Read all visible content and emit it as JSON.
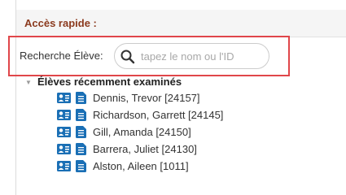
{
  "panel": {
    "title": "Accès rapide :"
  },
  "search": {
    "label": "Recherche Élève:",
    "placeholder": "tapez le nom ou l'ID",
    "value": "",
    "icon": "search-icon"
  },
  "recent": {
    "title": "Élèves récemment examinés",
    "toggle_icon": "caret-down-icon",
    "students": [
      {
        "label": "Dennis, Trevor [24157]"
      },
      {
        "label": "Richardson, Garrett [24145]"
      },
      {
        "label": "Gill, Amanda [24150]"
      },
      {
        "label": "Barrera, Juliet [24130]"
      },
      {
        "label": "Alston, Aileen [1011]"
      }
    ]
  },
  "colors": {
    "title": "#8b3a1e",
    "icon_blue": "#1a6fb5",
    "highlight": "#e0464a",
    "header_bg": "#f5f5f5"
  }
}
